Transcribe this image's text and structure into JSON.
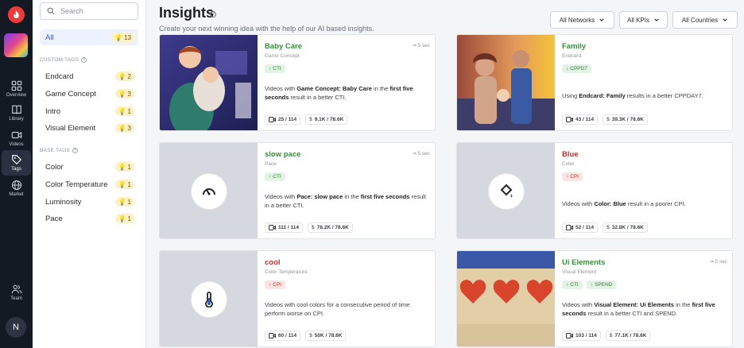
{
  "rail": {
    "items": [
      {
        "label": "Overview",
        "icon": "grid-icon"
      },
      {
        "label": "Library",
        "icon": "book-icon"
      },
      {
        "label": "Videos",
        "icon": "video-icon"
      },
      {
        "label": "Tags",
        "icon": "tag-icon",
        "active": true
      },
      {
        "label": "Market",
        "icon": "globe-icon"
      },
      {
        "label": "Team",
        "icon": "team-icon"
      }
    ],
    "avatar": "N"
  },
  "sidebar": {
    "search_placeholder": "Search",
    "all": {
      "label": "All",
      "count": "13"
    },
    "custom_title": "CUSTOM TAGS",
    "custom_tags": [
      {
        "label": "Endcard",
        "count": "2"
      },
      {
        "label": "Game Concept",
        "count": "3"
      },
      {
        "label": "Intro",
        "count": "1"
      },
      {
        "label": "Visual Element",
        "count": "3"
      }
    ],
    "base_title": "BASE TAGS",
    "base_tags": [
      {
        "label": "Color",
        "count": "1"
      },
      {
        "label": "Color Temperature",
        "count": "1"
      },
      {
        "label": "Luminosity",
        "count": "1"
      },
      {
        "label": "Pace",
        "count": "1"
      }
    ]
  },
  "header": {
    "title": "Insights",
    "help": "?",
    "subtitle": "Create your next winning idea with the help of our AI based insights.",
    "filters": [
      "All Networks",
      "All KPIs",
      "All Countries"
    ]
  },
  "cards": [
    {
      "title": "Baby Care",
      "tag": "Game Concept",
      "tone": "good",
      "pills": [
        {
          "dir": "up",
          "label": "CTI"
        }
      ],
      "duration": "5 sec",
      "desc_pre": "Videos with ",
      "desc_bold": "Game Concept: Baby Care",
      "desc_mid": " in the ",
      "desc_bold2": "first five seconds",
      "desc_post": " result in a better CTI.",
      "videos": "25 / 114",
      "spend": "9.1K / 78.6K",
      "thumb": "babycare"
    },
    {
      "title": "Family",
      "tag": "Endcard",
      "tone": "good",
      "pills": [
        {
          "dir": "down",
          "label": "CPPD7"
        }
      ],
      "duration": "",
      "desc_pre": "Using ",
      "desc_bold": "Endcard: Family",
      "desc_mid": " results in a better CPPDAY7.",
      "desc_bold2": "",
      "desc_post": "",
      "videos": "43 / 114",
      "spend": "39.3K / 78.6K",
      "thumb": "family"
    },
    {
      "title": "slow pace",
      "tag": "Pace",
      "tone": "good",
      "pills": [
        {
          "dir": "up",
          "label": "CTI"
        }
      ],
      "duration": "5 sec",
      "desc_pre": "Videos with ",
      "desc_bold": "Pace: slow pace",
      "desc_mid": " in the ",
      "desc_bold2": "first five seconds",
      "desc_post": " result in a better CTI.",
      "videos": "111 / 114",
      "spend": "78.2K / 78.6K",
      "thumb": "gauge"
    },
    {
      "title": "Blue",
      "tag": "Color",
      "tone": "bad",
      "pills": [
        {
          "dir": "up-bad",
          "label": "CPI"
        }
      ],
      "duration": "",
      "desc_pre": "Videos with ",
      "desc_bold": "Color: Blue",
      "desc_mid": " result in a poorer CPI.",
      "desc_bold2": "",
      "desc_post": "",
      "videos": "52 / 114",
      "spend": "32.8K / 78.6K",
      "thumb": "bucket"
    },
    {
      "title": "cool",
      "tag": "Color Temperature",
      "tone": "bad",
      "pills": [
        {
          "dir": "up-bad",
          "label": "CPI"
        }
      ],
      "duration": "",
      "desc_pre": "Videos with cool colors for a consecutive period of time perform worse on CPI.",
      "desc_bold": "",
      "desc_mid": "",
      "desc_bold2": "",
      "desc_post": "",
      "videos": "60 / 114",
      "spend": "50K / 78.6K",
      "thumb": "thermo"
    },
    {
      "title": "Ui Elements",
      "tag": "Visual Element",
      "tone": "good",
      "pills": [
        {
          "dir": "up",
          "label": "CTI"
        },
        {
          "dir": "up",
          "label": "SPEND"
        }
      ],
      "duration": "5 sec",
      "desc_pre": "Videos with ",
      "desc_bold": "Visual Element: Ui Elements",
      "desc_mid": " in the ",
      "desc_bold2": "first five seconds",
      "desc_post": " result in a better CTI and SPEND.",
      "videos": "103 / 114",
      "spend": "77.1K / 78.6K",
      "thumb": "hearts"
    }
  ]
}
